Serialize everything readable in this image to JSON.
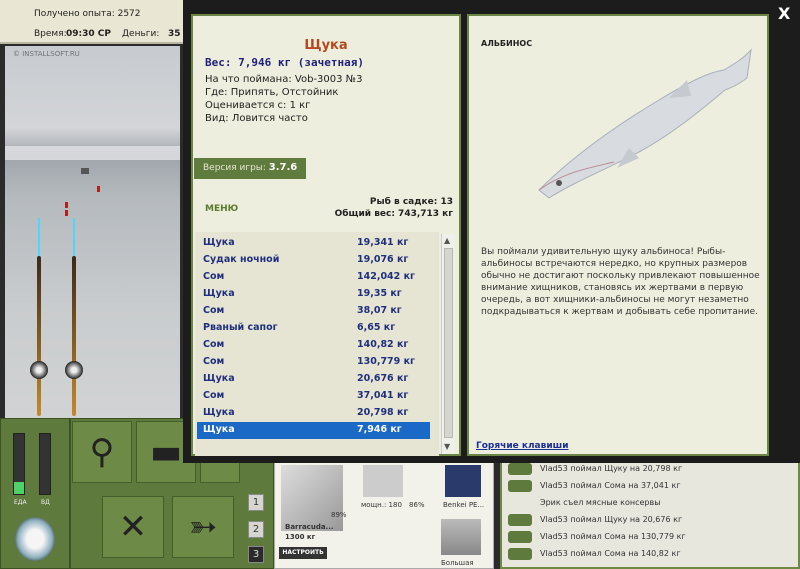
{
  "hud": {
    "exp_label": "Получено опыта: 2572",
    "time_label": "Время:",
    "time_value": "09:30 СР",
    "money_label": "Деньги:",
    "money_value": "35",
    "watermark": "© INSTALLSOFT.RU",
    "food_label": "ЕДА",
    "vd_label": "ВД"
  },
  "dialog": {
    "fish_name": "Щука",
    "weight_line": "Вес: 7,946 кг (зачетная)",
    "caught_on": "На что поймана: Vob-3003 №3",
    "where": "Где: Припять, Отстойник",
    "rated_from": "Оценивается с: 1 кг",
    "kind": "Вид: Ловится часто",
    "version_label": "Версия игры: ",
    "version_value": "3.7.6",
    "menu_label": "МЕНЮ",
    "sadok_count": "Рыб в садке: 13",
    "total_weight": "Общий вес: 743,713 кг",
    "close_label": "X"
  },
  "catch_list": [
    {
      "name": "Щука",
      "weight": "19,341 кг"
    },
    {
      "name": "Судак ночной",
      "weight": "19,076 кг"
    },
    {
      "name": "Сом",
      "weight": "142,042 кг"
    },
    {
      "name": "Щука",
      "weight": "19,35 кг"
    },
    {
      "name": "Сом",
      "weight": "38,07 кг"
    },
    {
      "name": "Рваный сапог",
      "weight": "6,65 кг"
    },
    {
      "name": "Сом",
      "weight": "140,82 кг"
    },
    {
      "name": "Сом",
      "weight": "130,779 кг"
    },
    {
      "name": "Щука",
      "weight": "20,676 кг"
    },
    {
      "name": "Сом",
      "weight": "37,041 кг"
    },
    {
      "name": "Щука",
      "weight": "20,798 кг"
    },
    {
      "name": "Щука",
      "weight": "7,946 кг",
      "selected": true
    }
  ],
  "fish_card": {
    "variant_label": "АЛЬБИНОС",
    "description": "Вы поймали удивительную щуку альбиноса! Рыбы-альбиносы встречаются нередко, но крупных размеров обычно не достигают поскольку привлекают повышенное внимание хищников, становясь их жертвами в первую очередь, а вот хищники-альбиносы не могут незаметно подкрадываться к жертвам и добывать себе пропитание.",
    "hotkeys_label": "Горячие клавиши"
  },
  "tackle": {
    "rod_name": "Barracuda...",
    "rod_test": "1300 кг",
    "build_label": "НАСТРОИТЬ",
    "pct1": "89%",
    "pct2": "86%",
    "reel_label": "мощн.: 180",
    "line_label": "Benkei PE...",
    "bait_label": "Большая"
  },
  "slot_numbers": [
    "1",
    "2",
    "3"
  ],
  "event_log": [
    "Vlad53 поймал Щуку на 20,798 кг",
    "Vlad53 поймал Сома на 37,041 кг",
    "Эрик съел мясные консервы",
    "Vlad53 поймал Щуку на 20,676 кг",
    "Vlad53 поймал Сома на 130,779 кг",
    "Vlad53 поймал Сома на 140,82 кг"
  ],
  "colors": {
    "panel_green": "#5e7a3c",
    "card_bg": "#eeeedf",
    "title_orange": "#b5491e",
    "list_text_blue": "#1f2f7c",
    "selection_blue": "#1a69c6"
  }
}
